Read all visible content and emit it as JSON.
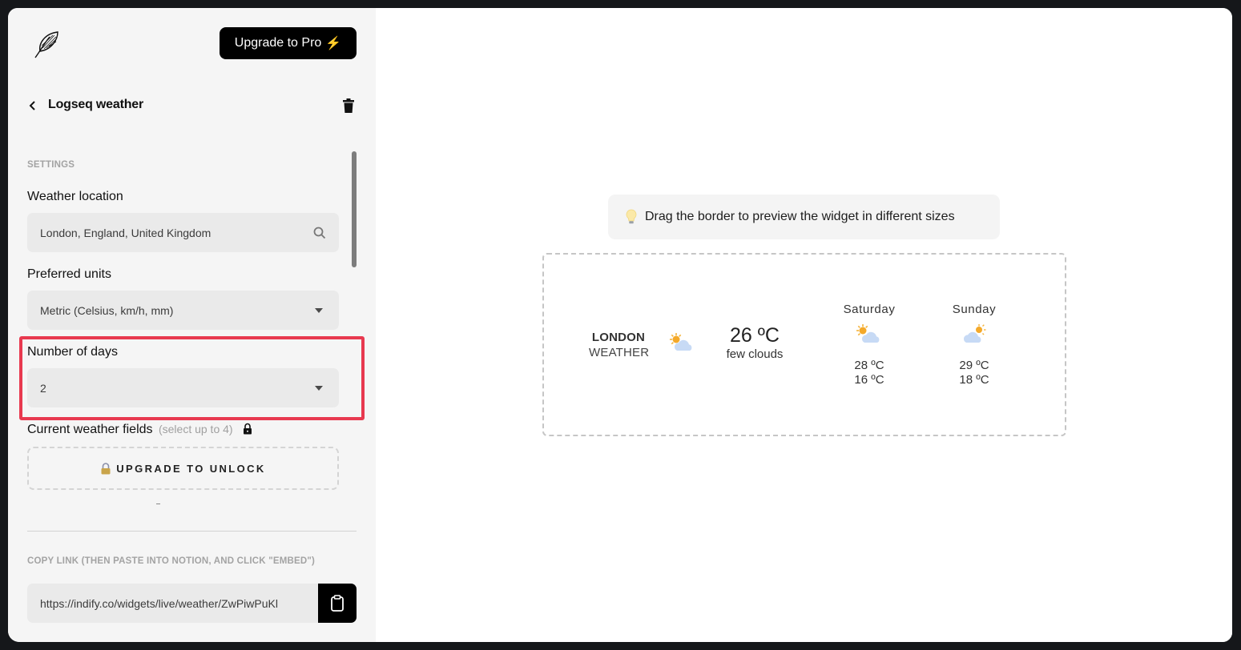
{
  "header": {
    "upgrade_label": "Upgrade to Pro",
    "upgrade_icon": "lightning-bolt-icon",
    "widget_title": "Logseq weather"
  },
  "settings": {
    "section_label": "SETTINGS",
    "location": {
      "label": "Weather location",
      "value": "London, England, United Kingdom"
    },
    "units": {
      "label": "Preferred units",
      "value": "Metric (Celsius, km/h, mm)"
    },
    "days": {
      "label": "Number of days",
      "value": "2"
    },
    "fields": {
      "label": "Current weather fields",
      "hint": "(select up to 4)",
      "unlock_label": "UPGRADE TO UNLOCK"
    },
    "tiny_mark": "-"
  },
  "copy_link": {
    "section_label": "COPY LINK (THEN PASTE INTO NOTION, AND CLICK \"EMBED\")",
    "url": "https://indify.co/widgets/live/weather/ZwPiwPuKl"
  },
  "preview": {
    "tip": "Drag the border to preview the widget in different sizes",
    "highlight_color": "#e8394f",
    "widget": {
      "city": "LONDON",
      "city_sub": "WEATHER",
      "current_temp": "26 ºC",
      "current_desc": "few clouds",
      "current_icon": "sun-behind-cloud-icon",
      "days": [
        {
          "name": "Saturday",
          "icon": "sun-behind-cloud-icon",
          "high": "28 ºC",
          "low": "16 ºC"
        },
        {
          "name": "Sunday",
          "icon": "cloud-with-sun-icon",
          "high": "29 ºC",
          "low": "18 ºC"
        }
      ]
    }
  }
}
